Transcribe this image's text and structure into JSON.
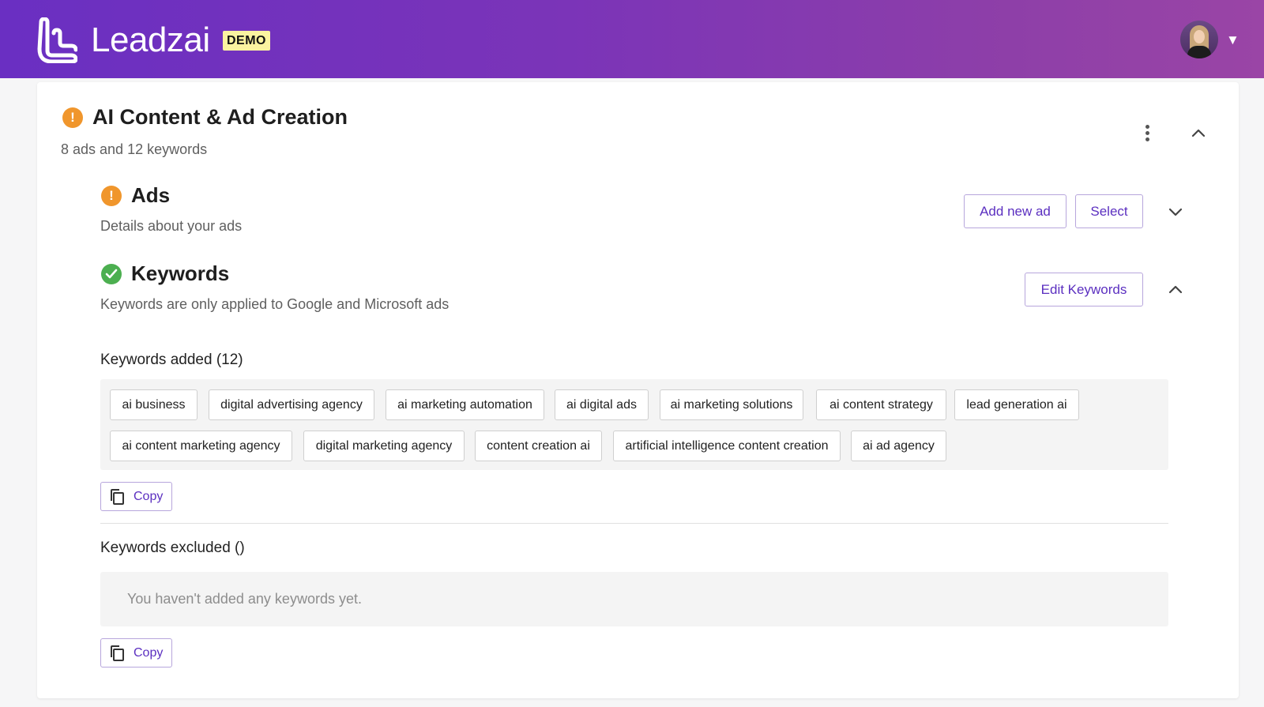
{
  "header": {
    "logo_text": "Leadzai",
    "badge": "DEMO",
    "avatar_alt": "user avatar",
    "colors": {
      "gradient_start": "#6a2fc2",
      "gradient_end": "#9a45a6",
      "badge_bg": "#fbf3a0"
    }
  },
  "campaign": {
    "title": "AI Content & Ad Creation",
    "subtitle": "8 ads and 12 keywords",
    "status_icon": "warning-icon",
    "menu_icon": "kebab-menu-icon",
    "collapse_icon": "chevron-up-icon"
  },
  "ads": {
    "title": "Ads",
    "subtitle": "Details about your ads",
    "status_icon": "warning-icon",
    "add_button": "Add new ad",
    "select_button": "Select",
    "expand_icon": "chevron-down-icon"
  },
  "keywords": {
    "title": "Keywords",
    "subtitle": "Keywords are only applied to Google and Microsoft ads",
    "status_icon": "check-circle-icon",
    "edit_button": "Edit Keywords",
    "collapse_icon": "chevron-up-icon",
    "added_title": "Keywords added (12)",
    "added": [
      "ai business",
      "digital advertising agency",
      "ai marketing automation",
      "ai digital ads",
      "ai marketing solutions",
      "ai content strategy",
      "lead generation ai",
      "ai content marketing agency",
      "digital marketing agency",
      "content creation ai",
      "artificial intelligence content creation",
      "ai ad agency"
    ],
    "copy_label": "Copy",
    "excluded_title": "Keywords excluded ()",
    "excluded_empty": "You haven't added any keywords yet.",
    "copy_label_2": "Copy"
  },
  "colors": {
    "accent": "#5b2fc0",
    "warning": "#f0962c",
    "success": "#4caf50"
  }
}
